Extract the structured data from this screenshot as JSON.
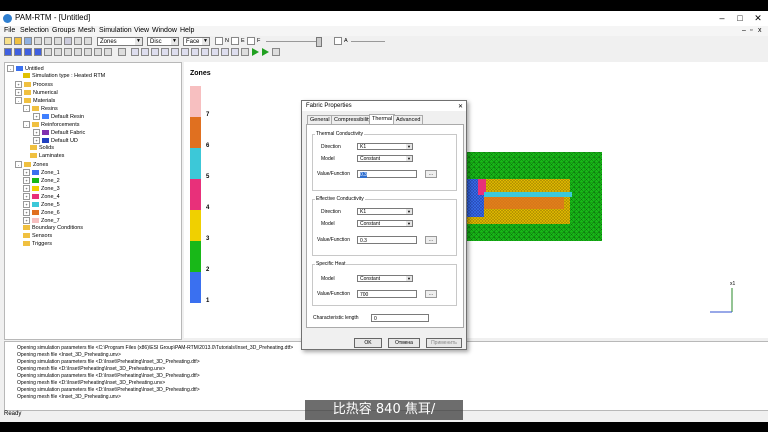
{
  "window": {
    "title": "PAM-RTM - [Untitled]",
    "min": "–",
    "max": "□",
    "close": "✕"
  },
  "menu": [
    "File",
    "Selection",
    "Groups",
    "Mesh",
    "Simulation",
    "View",
    "Window",
    "Help"
  ],
  "toolbar": {
    "combo_zones": "Zones",
    "combo_disc": "Disc",
    "combo_face": "Face",
    "check_labels": [
      "N",
      "E",
      "F"
    ],
    "check_a": "A"
  },
  "tree": {
    "root": "Untitled",
    "sim_type": "Simulation type : Heated RTM",
    "process": "Process",
    "numerical": "Numerical",
    "materials": "Materials",
    "resins": "Resins",
    "default_resin": "Default Resin",
    "reinforcements": "Reinforcements",
    "default_fabric": "Default Fabric",
    "default_ud": "Default UD",
    "solids": "Solids",
    "laminates": "Laminates",
    "zones": "Zones",
    "zone_items": [
      "Zone_1",
      "Zone_2",
      "Zone_3",
      "Zone_4",
      "Zone_5",
      "Zone_6",
      "Zone_7"
    ],
    "boundary": "Boundary Conditions",
    "sensors": "Sensors",
    "triggers": "Triggers"
  },
  "view": {
    "title": "Zones",
    "legend": [
      {
        "label": "7",
        "color": "#f7bfc0"
      },
      {
        "label": "6",
        "color": "#e07020"
      },
      {
        "label": "5",
        "color": "#3cc8d8"
      },
      {
        "label": "4",
        "color": "#e8307a"
      },
      {
        "label": "3",
        "color": "#f0d000"
      },
      {
        "label": "2",
        "color": "#18b818"
      },
      {
        "label": "1",
        "color": "#3a70f0"
      }
    ],
    "axis_label": "x1"
  },
  "dialog": {
    "title": "Fabric Properties",
    "close": "✕",
    "tabs": [
      "General",
      "Compressibility",
      "Thermal",
      "Advanced"
    ],
    "active_tab": "Thermal",
    "thermal_conductivity": {
      "group": "Thermal Conductivity",
      "direction_label": "Direction",
      "direction_value": "K1",
      "model_label": "Model",
      "model_value": "Constant",
      "value_label": "Value/Function",
      "value": "0.3"
    },
    "effective_conductivity": {
      "group": "Effective Conductivity",
      "direction_label": "Direction",
      "direction_value": "K1",
      "model_label": "Model",
      "model_value": "Constant",
      "value_label": "Value/Function",
      "value": "0.3"
    },
    "specific_heat": {
      "group": "Specific Heat",
      "model_label": "Model",
      "model_value": "Constant",
      "value_label": "Value/Function",
      "value": "700"
    },
    "char_length_label": "Characteristic length",
    "char_length_value": "0",
    "dots": "...",
    "ok": "OK",
    "cancel": "Отмена",
    "apply": "Применить"
  },
  "log": [
    "Opening simulation parameters file <C:\\Program Files (x86)\\ESI Group\\PAM-RTM\\2013.0\\Tutorials\\Inset_3D_Preheating.dtf>",
    "Opening mesh file <Inset_3D_Preheating.unv>",
    "Opening simulation parameters file <D:\\Inset\\Preheating\\Inset_3D_Preheating.dtf>",
    "Opening mesh file <D:\\Inset\\Preheating\\Inset_3D_Preheating.unv>",
    "Opening simulation parameters file <D:\\Inset\\Preheating\\Inset_3D_Preheating.dtf>",
    "Opening mesh file <D:\\Inset\\Preheating\\Inset_3D_Preheating.unv>",
    "Opening simulation parameters file <D:\\Inset\\Preheating\\Inset_3D_Preheating.dtf>",
    "Opening mesh file <Inset_3D_Preheating.unv>"
  ],
  "status": "Ready",
  "subtitle": "比热容 840 焦耳/"
}
